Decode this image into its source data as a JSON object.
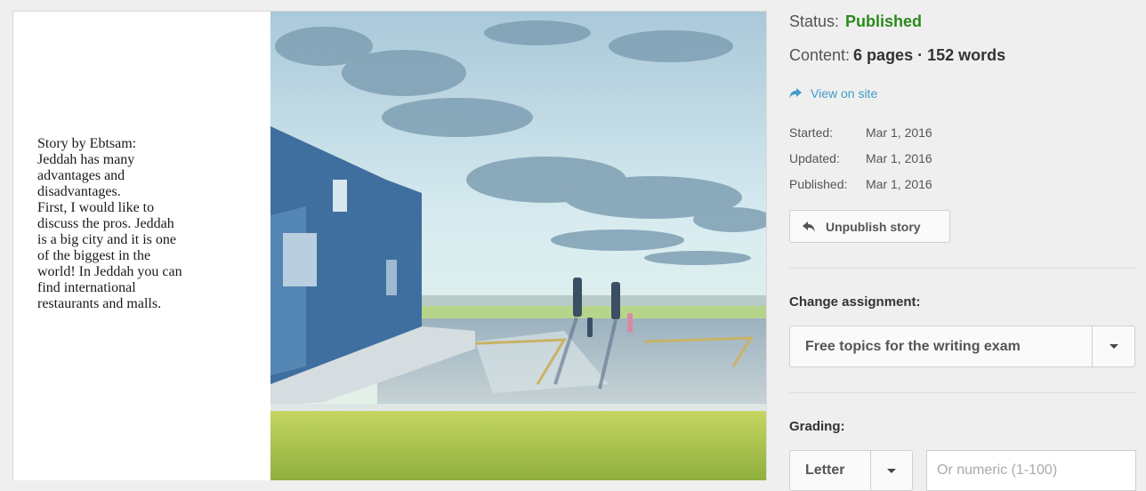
{
  "story": {
    "text": "Story by Ebtsam:\nJeddah has many\nadvantages and\ndisadvantages.\nFirst, I would like to\ndiscuss the pros. Jeddah\nis a big city and it is one\nof the biggest in the\nworld! In Jeddah you can\nfind international\nrestaurants and malls."
  },
  "sidebar": {
    "status_label": "Status:",
    "status_value": "Published",
    "content_label": "Content:",
    "content_value": "6 pages · 152 words",
    "view_link": "View on site",
    "dates": [
      {
        "label": "Started:",
        "value": "Mar 1, 2016"
      },
      {
        "label": "Updated:",
        "value": "Mar 1, 2016"
      },
      {
        "label": "Published:",
        "value": "Mar 1, 2016"
      }
    ],
    "unpublish_label": "Unpublish story",
    "assignment_label": "Change assignment:",
    "assignment_value": "Free topics for the writing exam",
    "grading_label": "Grading:",
    "grading_letter": "Letter",
    "grading_numeric_placeholder": "Or numeric (1-100)"
  },
  "colors": {
    "status_green": "#2b8a1c",
    "link_blue": "#3f9dc7",
    "panel_bg": "#efefef"
  },
  "icons": {
    "view_link": "share-arrow-icon",
    "unpublish": "reply-arrow-icon",
    "dropdown": "caret-down-icon"
  }
}
